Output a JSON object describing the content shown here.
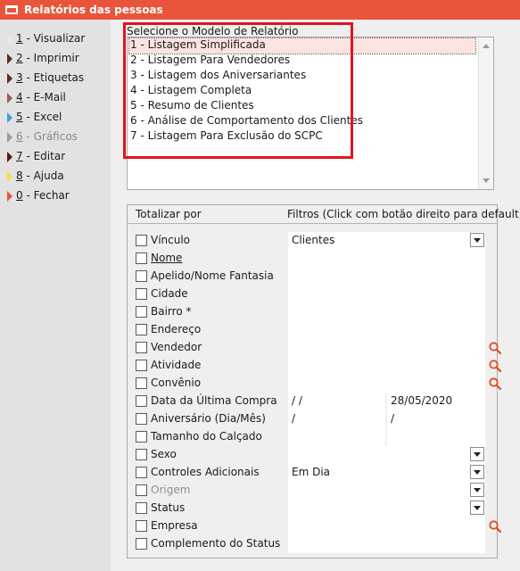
{
  "window": {
    "title": "Relatórios das pessoas"
  },
  "sidebar": {
    "items": [
      {
        "key": "1",
        "label": " - Visualizar",
        "icon": "play-icon-white",
        "color": "#e8e8e8",
        "disabled": false
      },
      {
        "key": "2",
        "label": " - Imprimir",
        "icon": "play-icon-dark",
        "color": "#5a2e1e",
        "disabled": false
      },
      {
        "key": "3",
        "label": " - Etiquetas",
        "icon": "play-icon-dark",
        "color": "#5a2e1e",
        "disabled": false
      },
      {
        "key": "4",
        "label": " - E-Mail",
        "icon": "play-icon-rose",
        "color": "#9a5a5a",
        "disabled": false
      },
      {
        "key": "5",
        "label": " - Excel",
        "icon": "play-icon-blue",
        "color": "#3aa0d8",
        "disabled": false
      },
      {
        "key": "6",
        "label": " - Gráficos",
        "icon": "play-icon-gray",
        "color": "#9a9a9a",
        "disabled": true
      },
      {
        "key": "7",
        "label": " - Editar",
        "icon": "play-icon-darkred",
        "color": "#5a1a1a",
        "disabled": false
      },
      {
        "key": "8",
        "label": " - Ajuda",
        "icon": "play-icon-yellow",
        "color": "#f0e040",
        "disabled": false
      },
      {
        "key": "0",
        "label": " - Fechar",
        "icon": "play-icon-orange",
        "color": "#e8553a",
        "disabled": false
      }
    ]
  },
  "report_models": {
    "label": "Selecione o Modelo de Relatório",
    "items": [
      "1 - Listagem Simplificada",
      "2 - Listagem Para Vendedores",
      "3 - Listagem dos Aniversariantes",
      "4 - Listagem Completa",
      "5 - Resumo de Clientes",
      "6 - Análise de Comportamento dos Clientes",
      "7 - Listagem Para Exclusão do SCPC"
    ],
    "selected_index": 0
  },
  "filters_panel": {
    "header_totalize": "Totalizar por",
    "header_filters": "Filtros (Click com botão direito para default)",
    "rows": [
      {
        "label": "Vínculo",
        "filter": "dropdown",
        "value": "Clientes"
      },
      {
        "label": "Nome",
        "filter": "text",
        "value": "",
        "underline": true
      },
      {
        "label": "Apelido/Nome Fantasia",
        "filter": "text",
        "value": ""
      },
      {
        "label": "Cidade",
        "filter": "text",
        "value": ""
      },
      {
        "label": "Bairro *",
        "filter": "text",
        "value": ""
      },
      {
        "label": "Endereço",
        "filter": "text",
        "value": ""
      },
      {
        "label": "Vendedor",
        "filter": "text",
        "value": "",
        "search": true
      },
      {
        "label": "Atividade",
        "filter": "text",
        "value": "",
        "search": true
      },
      {
        "label": "Convênio",
        "filter": "text",
        "value": "",
        "search": true
      },
      {
        "label": "Data da Última Compra",
        "filter": "range",
        "from": " /  /",
        "to": "28/05/2020"
      },
      {
        "label": "Aniversário (Dia/Mês)",
        "filter": "range",
        "from": " /",
        "to": " /"
      },
      {
        "label": "Tamanho do Calçado",
        "filter": "range",
        "from": "",
        "to": ""
      },
      {
        "label": "Sexo",
        "filter": "dropdown",
        "value": ""
      },
      {
        "label": "Controles Adicionais",
        "filter": "dropdown",
        "value": "Em Dia"
      },
      {
        "label": "Origem",
        "filter": "dropdown",
        "value": "",
        "disabled": true
      },
      {
        "label": "Status",
        "filter": "dropdown",
        "value": ""
      },
      {
        "label": "Empresa",
        "filter": "text",
        "value": "",
        "search": true
      },
      {
        "label": "Complemento do Status",
        "filter": "text",
        "value": ""
      }
    ]
  },
  "colors": {
    "title_bar": "#e8553a",
    "highlight_frame": "#e0151f",
    "selected_item": "#fbe3e0",
    "search_icon": "#e04b1f"
  }
}
